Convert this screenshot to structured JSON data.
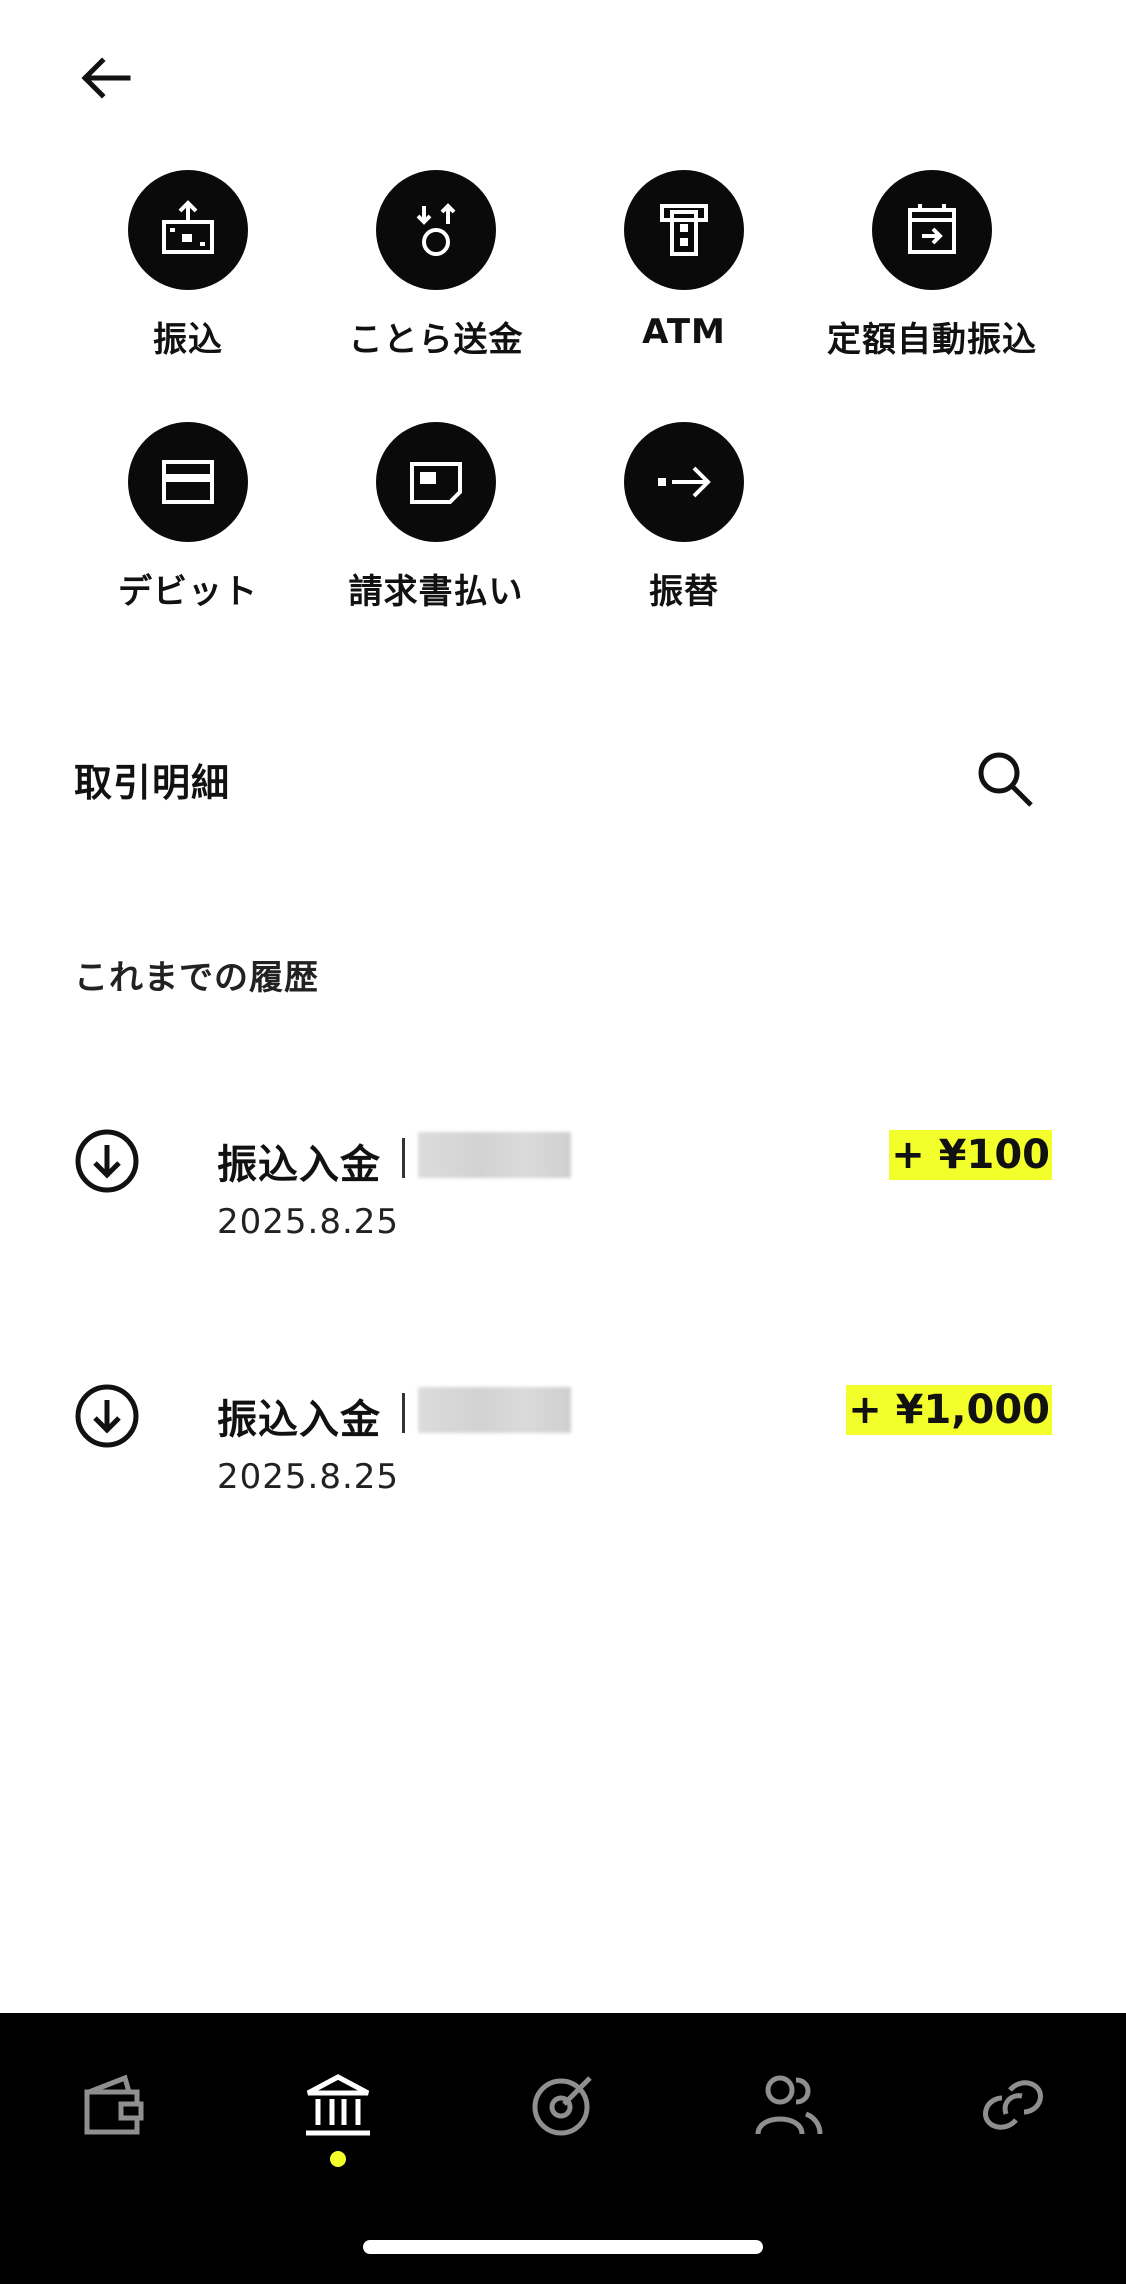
{
  "header": {
    "back_icon": "arrow-left-icon"
  },
  "actions": [
    {
      "label": "振込",
      "icon": "transfer-money-icon"
    },
    {
      "label": "ことら送金",
      "icon": "kotora-send-icon"
    },
    {
      "label": "ATM",
      "icon": "atm-icon"
    },
    {
      "label": "定額自動振込",
      "icon": "calendar-transfer-icon"
    },
    {
      "label": "デビット",
      "icon": "card-icon"
    },
    {
      "label": "請求書払い",
      "icon": "bill-icon"
    },
    {
      "label": "振替",
      "icon": "arrow-right-icon"
    }
  ],
  "transactions": {
    "title": "取引明細",
    "search_icon": "search-icon",
    "history_title": "これまでの履歴",
    "items": [
      {
        "title": "振込入金",
        "date": "2025.8.25",
        "amount": "+ ¥100",
        "icon": "arrow-down-circle-icon"
      },
      {
        "title": "振込入金",
        "date": "2025.8.25",
        "amount": "+ ¥1,000",
        "icon": "arrow-down-circle-icon"
      }
    ]
  },
  "tabbar": {
    "active_index": 1,
    "accent_color": "#f3ff2a",
    "tabs": [
      {
        "icon": "wallet-icon"
      },
      {
        "icon": "bank-icon"
      },
      {
        "icon": "target-icon"
      },
      {
        "icon": "people-icon"
      },
      {
        "icon": "link-icon"
      }
    ]
  },
  "colors": {
    "highlight": "#f3ff2a",
    "tab_active": "#ffffff",
    "tab_inactive": "#8f8f8f"
  }
}
